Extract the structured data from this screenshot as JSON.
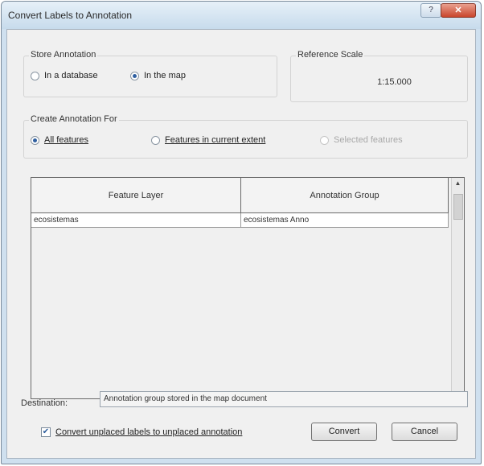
{
  "window": {
    "title": "Convert Labels to Annotation",
    "help_glyph": "?",
    "close_glyph": "✕"
  },
  "store_annotation": {
    "legend": "Store Annotation",
    "options": [
      {
        "label": "In a database",
        "selected": false
      },
      {
        "label": "In the map",
        "selected": true
      }
    ]
  },
  "reference_scale": {
    "legend": "Reference Scale",
    "value": "1:15.000"
  },
  "create_for": {
    "legend": "Create Annotation For",
    "options": [
      {
        "label": "All features",
        "selected": true,
        "enabled": true
      },
      {
        "label": "Features in current extent",
        "selected": false,
        "enabled": true
      },
      {
        "label": "Selected features",
        "selected": false,
        "enabled": false
      }
    ]
  },
  "table": {
    "headers": [
      "Feature Layer",
      "Annotation Group"
    ],
    "rows": [
      [
        "ecosistemas",
        "ecosistemas Anno"
      ]
    ]
  },
  "destination": {
    "label": "Destination:",
    "value": "Annotation group stored in the map document"
  },
  "convert_unplaced": {
    "label": "Convert unplaced labels to unplaced annotation",
    "checked": true
  },
  "buttons": {
    "convert": "Convert",
    "cancel": "Cancel"
  }
}
